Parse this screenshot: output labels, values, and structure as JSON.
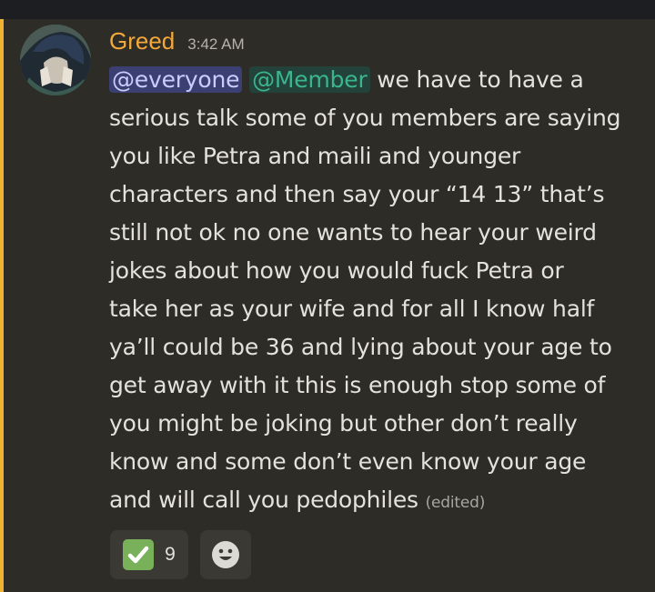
{
  "message": {
    "author": "Greed",
    "timestamp": "3:42 AM",
    "mentions": [
      "@everyone",
      "@Member"
    ],
    "body_start": " we have to have a",
    "lines": [
      "serious talk some of you members are saying",
      "you like Petra and maili and younger",
      "characters and then say your “14 13” that’s",
      "still not ok no one wants to hear your weird",
      "jokes about how you would fuck Petra or",
      "take her as your wife and for all I know half",
      "ya’ll could be 36 and lying about your age to",
      "get away with it this is enough stop some of",
      "you might be joking but other don’t really",
      "know and some don’t even know your age",
      "and will call you pedophiles"
    ],
    "edited_label": "(edited)",
    "accent_color": "#f0b232",
    "author_color": "#f4a83a"
  },
  "reactions": [
    {
      "icon": "check-mark-icon",
      "count": "9"
    },
    {
      "icon": "add-reaction-smiley-icon"
    }
  ]
}
